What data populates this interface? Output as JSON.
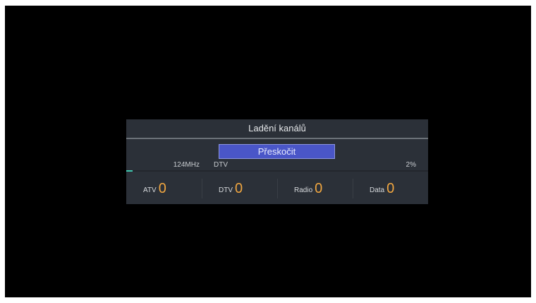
{
  "dialog": {
    "title": "Ladění kanálů",
    "skip_label": "Přeskočit",
    "frequency": "124MHz",
    "mode": "DTV",
    "progress_text": "2%",
    "progress_fraction": 0.02
  },
  "counters": [
    {
      "label": "ATV",
      "value": "0"
    },
    {
      "label": "DTV",
      "value": "0"
    },
    {
      "label": "Radio",
      "value": "0"
    },
    {
      "label": "Data",
      "value": "0"
    }
  ],
  "colors": {
    "background": "#000000",
    "panel": "#2b3038",
    "button": "#4a56c8",
    "count_accent": "#f0a640",
    "progress": "#3fc7b0"
  }
}
